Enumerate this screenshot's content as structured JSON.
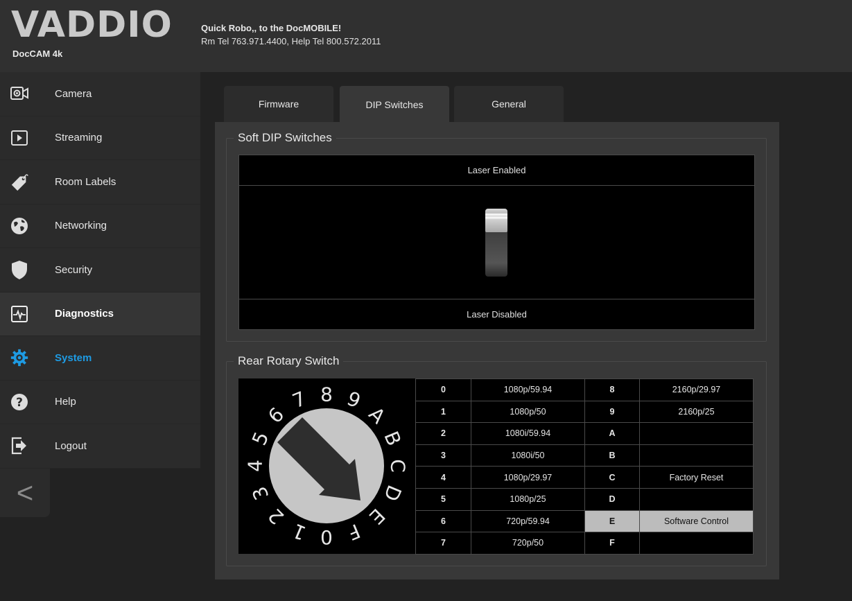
{
  "header": {
    "logo": "VADDIO",
    "model": "DocCAM 4k",
    "line1": "Quick Robo,, to the DocMOBILE!",
    "line2": "Rm Tel 763.971.4400, Help Tel 800.572.2011"
  },
  "sidebar": {
    "items": [
      {
        "label": "Camera",
        "icon": "camera-icon"
      },
      {
        "label": "Streaming",
        "icon": "play-icon"
      },
      {
        "label": "Room Labels",
        "icon": "tag-icon"
      },
      {
        "label": "Networking",
        "icon": "globe-icon"
      },
      {
        "label": "Security",
        "icon": "shield-icon"
      },
      {
        "label": "Diagnostics",
        "icon": "pulse-icon"
      },
      {
        "label": "System",
        "icon": "gear-icon"
      },
      {
        "label": "Help",
        "icon": "question-icon"
      },
      {
        "label": "Logout",
        "icon": "logout-icon"
      }
    ],
    "collapse_glyph": "<",
    "accent_color": "#1e9be3"
  },
  "tabs": [
    {
      "label": "Firmware"
    },
    {
      "label": "DIP Switches"
    },
    {
      "label": "General"
    }
  ],
  "dip": {
    "title": "Soft DIP Switches",
    "top_label": "Laser Enabled",
    "bottom_label": "Laser Disabled",
    "state": "enabled"
  },
  "rotary": {
    "title": "Rear Rotary Switch",
    "dial_digits": [
      "0",
      "1",
      "2",
      "3",
      "4",
      "5",
      "6",
      "7",
      "8",
      "9",
      "A",
      "B",
      "C",
      "D",
      "E",
      "F"
    ],
    "selected": "E",
    "rows": [
      {
        "k1": "0",
        "v1": "1080p/59.94",
        "k2": "8",
        "v2": "2160p/29.97"
      },
      {
        "k1": "1",
        "v1": "1080p/50",
        "k2": "9",
        "v2": "2160p/25"
      },
      {
        "k1": "2",
        "v1": "1080i/59.94",
        "k2": "A",
        "v2": ""
      },
      {
        "k1": "3",
        "v1": "1080i/50",
        "k2": "B",
        "v2": ""
      },
      {
        "k1": "4",
        "v1": "1080p/29.97",
        "k2": "C",
        "v2": "Factory Reset"
      },
      {
        "k1": "5",
        "v1": "1080p/25",
        "k2": "D",
        "v2": ""
      },
      {
        "k1": "6",
        "v1": "720p/59.94",
        "k2": "E",
        "v2": "Software Control"
      },
      {
        "k1": "7",
        "v1": "720p/50",
        "k2": "F",
        "v2": ""
      }
    ]
  }
}
